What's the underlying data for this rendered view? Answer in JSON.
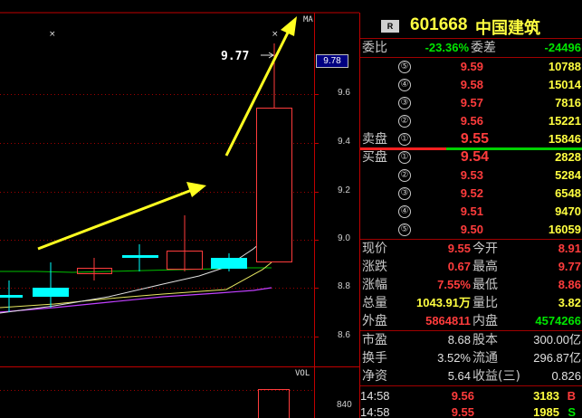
{
  "stock": {
    "badge": "R",
    "code": "601668",
    "name": "中国建筑"
  },
  "chart": {
    "ma_label": "MA",
    "vol_label": "VOL",
    "price_annotation": "9.77",
    "current_price_tag": "9.78",
    "y_ticks": [
      "9.6",
      "9.4",
      "9.2",
      "9.0",
      "8.8",
      "8.6"
    ],
    "vol_tick": "840"
  },
  "weibi": {
    "label1": "委比",
    "value1": "-23.36%",
    "label2": "委差",
    "value2": "-24496"
  },
  "sell_orders": [
    {
      "level": "⑤",
      "price": "9.59",
      "volume": "10788"
    },
    {
      "level": "④",
      "price": "9.58",
      "volume": "15014"
    },
    {
      "level": "③",
      "price": "9.57",
      "volume": "7816"
    },
    {
      "level": "②",
      "price": "9.56",
      "volume": "15221"
    },
    {
      "level": "①",
      "price": "9.55",
      "volume": "15846",
      "side_label": "卖盘"
    }
  ],
  "buy_orders": [
    {
      "level": "①",
      "price": "9.54",
      "volume": "2828",
      "side_label": "买盘"
    },
    {
      "level": "②",
      "price": "9.53",
      "volume": "5284"
    },
    {
      "level": "③",
      "price": "9.52",
      "volume": "6548"
    },
    {
      "level": "④",
      "price": "9.51",
      "volume": "9470"
    },
    {
      "level": "⑤",
      "price": "9.50",
      "volume": "16059"
    }
  ],
  "quote": {
    "xianjia_label": "现价",
    "xianjia": "9.55",
    "jinkai_label": "今开",
    "jinkai": "8.91",
    "zhangdie_label": "涨跌",
    "zhangdie": "0.67",
    "zuigao_label": "最高",
    "zuigao": "9.77",
    "zhangfu_label": "涨幅",
    "zhangfu": "7.55%",
    "zuidi_label": "最低",
    "zuidi": "8.86",
    "zongliang_label": "总量",
    "zongliang": "1043.91万",
    "liangbi_label": "量比",
    "liangbi": "3.82",
    "waipan_label": "外盘",
    "waipan": "5864811",
    "neipan_label": "内盘",
    "neipan": "4574266"
  },
  "fundamentals": {
    "shiying_label": "市盈",
    "shiying": "8.68",
    "guben_label": "股本",
    "guben": "300.00亿",
    "huanshou_label": "换手",
    "huanshou": "3.52%",
    "liutong_label": "流通",
    "liutong": "296.87亿",
    "jingzi_label": "净资",
    "jingzi": "5.64",
    "shouyi_label": "收益(三)",
    "shouyi": "0.826"
  },
  "ticks": [
    {
      "time": "14:58",
      "price": "9.56",
      "volume": "3183",
      "side": "B"
    },
    {
      "time": "14:58",
      "price": "9.55",
      "volume": "1985",
      "side": "S"
    }
  ],
  "colors": {
    "up": "#ff3c3c",
    "down": "#00e600",
    "accent": "#ffff40",
    "grid": "#a00000"
  }
}
